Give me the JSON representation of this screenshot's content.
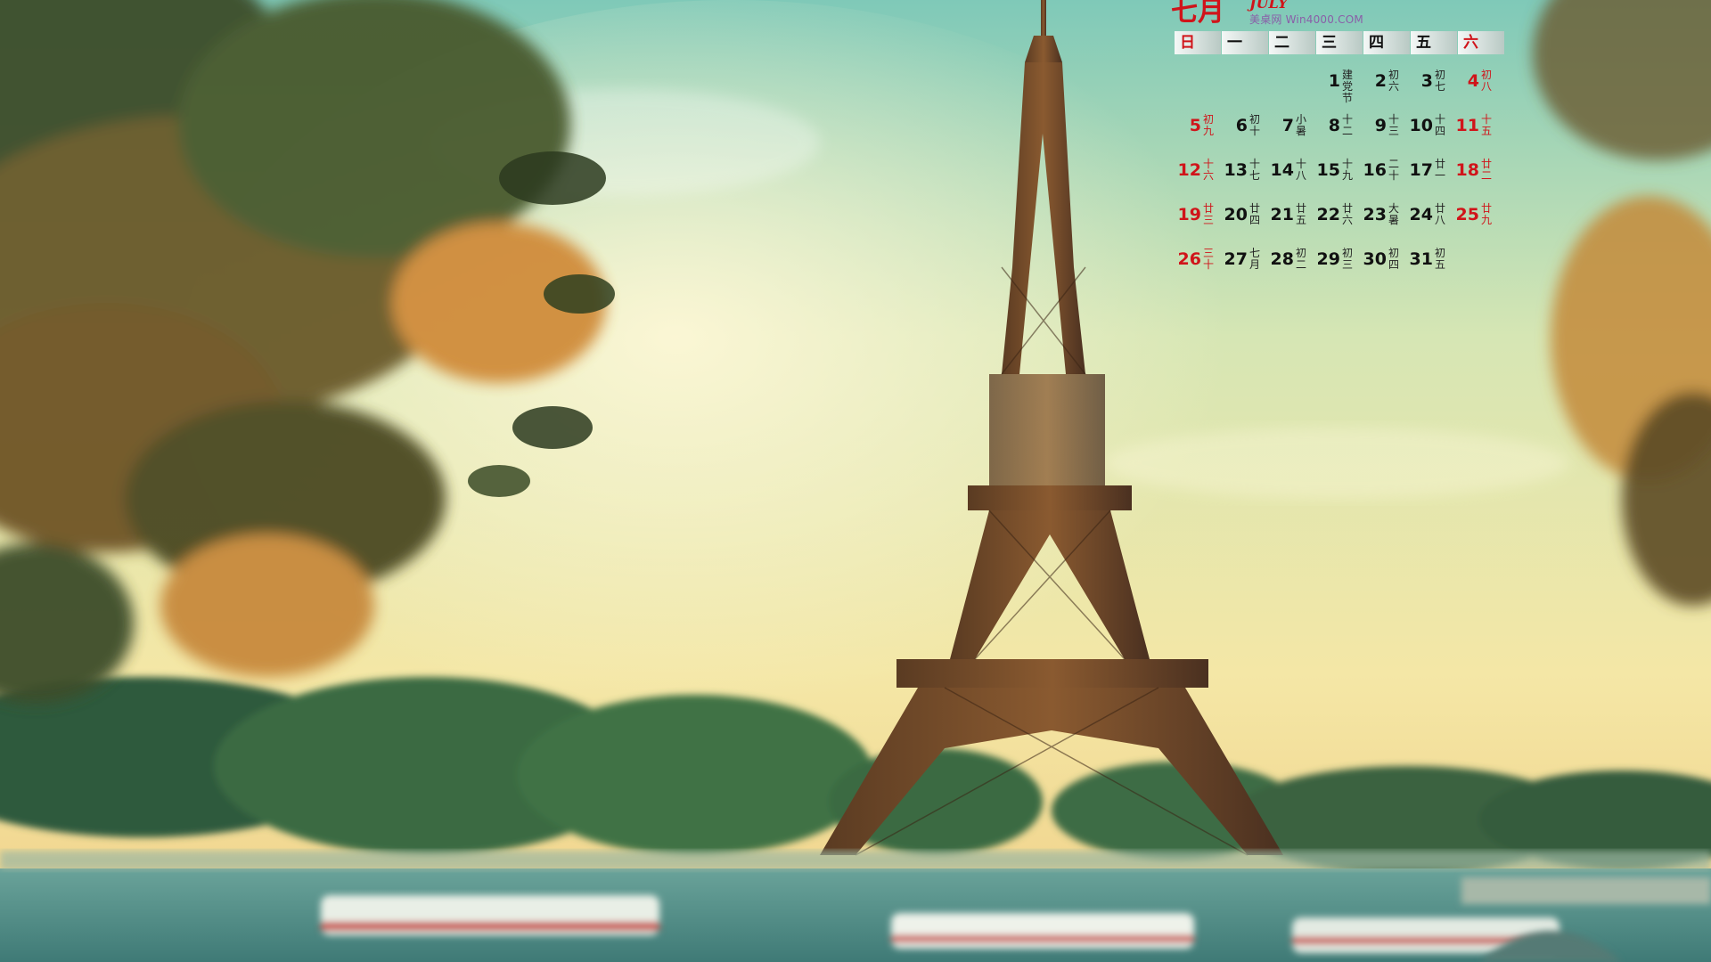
{
  "calendar": {
    "month_cn": "七月",
    "month_en": "JULY",
    "brand": "美桌网 Win4000.COM",
    "weekdays": [
      "日",
      "一",
      "二",
      "三",
      "四",
      "五",
      "六"
    ],
    "days": [
      {
        "d": "",
        "l": ""
      },
      {
        "d": "",
        "l": ""
      },
      {
        "d": "",
        "l": ""
      },
      {
        "d": "1",
        "l": "建党节"
      },
      {
        "d": "2",
        "l": "初六"
      },
      {
        "d": "3",
        "l": "初七"
      },
      {
        "d": "4",
        "l": "初八"
      },
      {
        "d": "5",
        "l": "初九"
      },
      {
        "d": "6",
        "l": "初十"
      },
      {
        "d": "7",
        "l": "小暑"
      },
      {
        "d": "8",
        "l": "十二"
      },
      {
        "d": "9",
        "l": "十三"
      },
      {
        "d": "10",
        "l": "十四"
      },
      {
        "d": "11",
        "l": "十五"
      },
      {
        "d": "12",
        "l": "十六"
      },
      {
        "d": "13",
        "l": "十七"
      },
      {
        "d": "14",
        "l": "十八"
      },
      {
        "d": "15",
        "l": "十九"
      },
      {
        "d": "16",
        "l": "二十"
      },
      {
        "d": "17",
        "l": "廿一"
      },
      {
        "d": "18",
        "l": "廿二"
      },
      {
        "d": "19",
        "l": "廿三"
      },
      {
        "d": "20",
        "l": "廿四"
      },
      {
        "d": "21",
        "l": "廿五"
      },
      {
        "d": "22",
        "l": "廿六"
      },
      {
        "d": "23",
        "l": "大暑"
      },
      {
        "d": "24",
        "l": "廿八"
      },
      {
        "d": "25",
        "l": "廿九"
      },
      {
        "d": "26",
        "l": "三十"
      },
      {
        "d": "27",
        "l": "七月"
      },
      {
        "d": "28",
        "l": "初二"
      },
      {
        "d": "29",
        "l": "初三"
      },
      {
        "d": "30",
        "l": "初四"
      },
      {
        "d": "31",
        "l": "初五"
      }
    ]
  },
  "colors": {
    "holiday_red": "#d0141a",
    "brand_purple": "#8a5ea8"
  }
}
